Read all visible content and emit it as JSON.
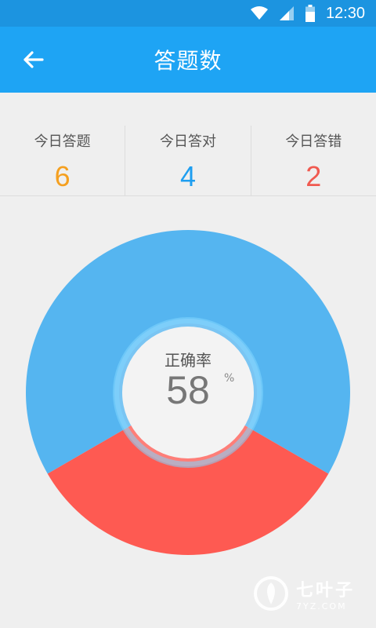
{
  "status_bar": {
    "time": "12:30"
  },
  "header": {
    "title": "答题数"
  },
  "stats": [
    {
      "label": "今日答题",
      "value": "6",
      "color": "#f5a020"
    },
    {
      "label": "今日答对",
      "value": "4",
      "color": "#1e9ef0"
    },
    {
      "label": "今日答错",
      "value": "2",
      "color": "#f05a50"
    }
  ],
  "accuracy": {
    "label": "正确率",
    "value": "58",
    "unit": "%"
  },
  "chart_data": {
    "type": "pie",
    "slices": [
      {
        "name": "今日答对",
        "value": 4,
        "color": "#55b5f0"
      },
      {
        "name": "今日答错",
        "value": 2,
        "color": "#fe5a52"
      }
    ]
  },
  "watermark": {
    "text": "七叶子",
    "sub": "7YZ.COM"
  }
}
